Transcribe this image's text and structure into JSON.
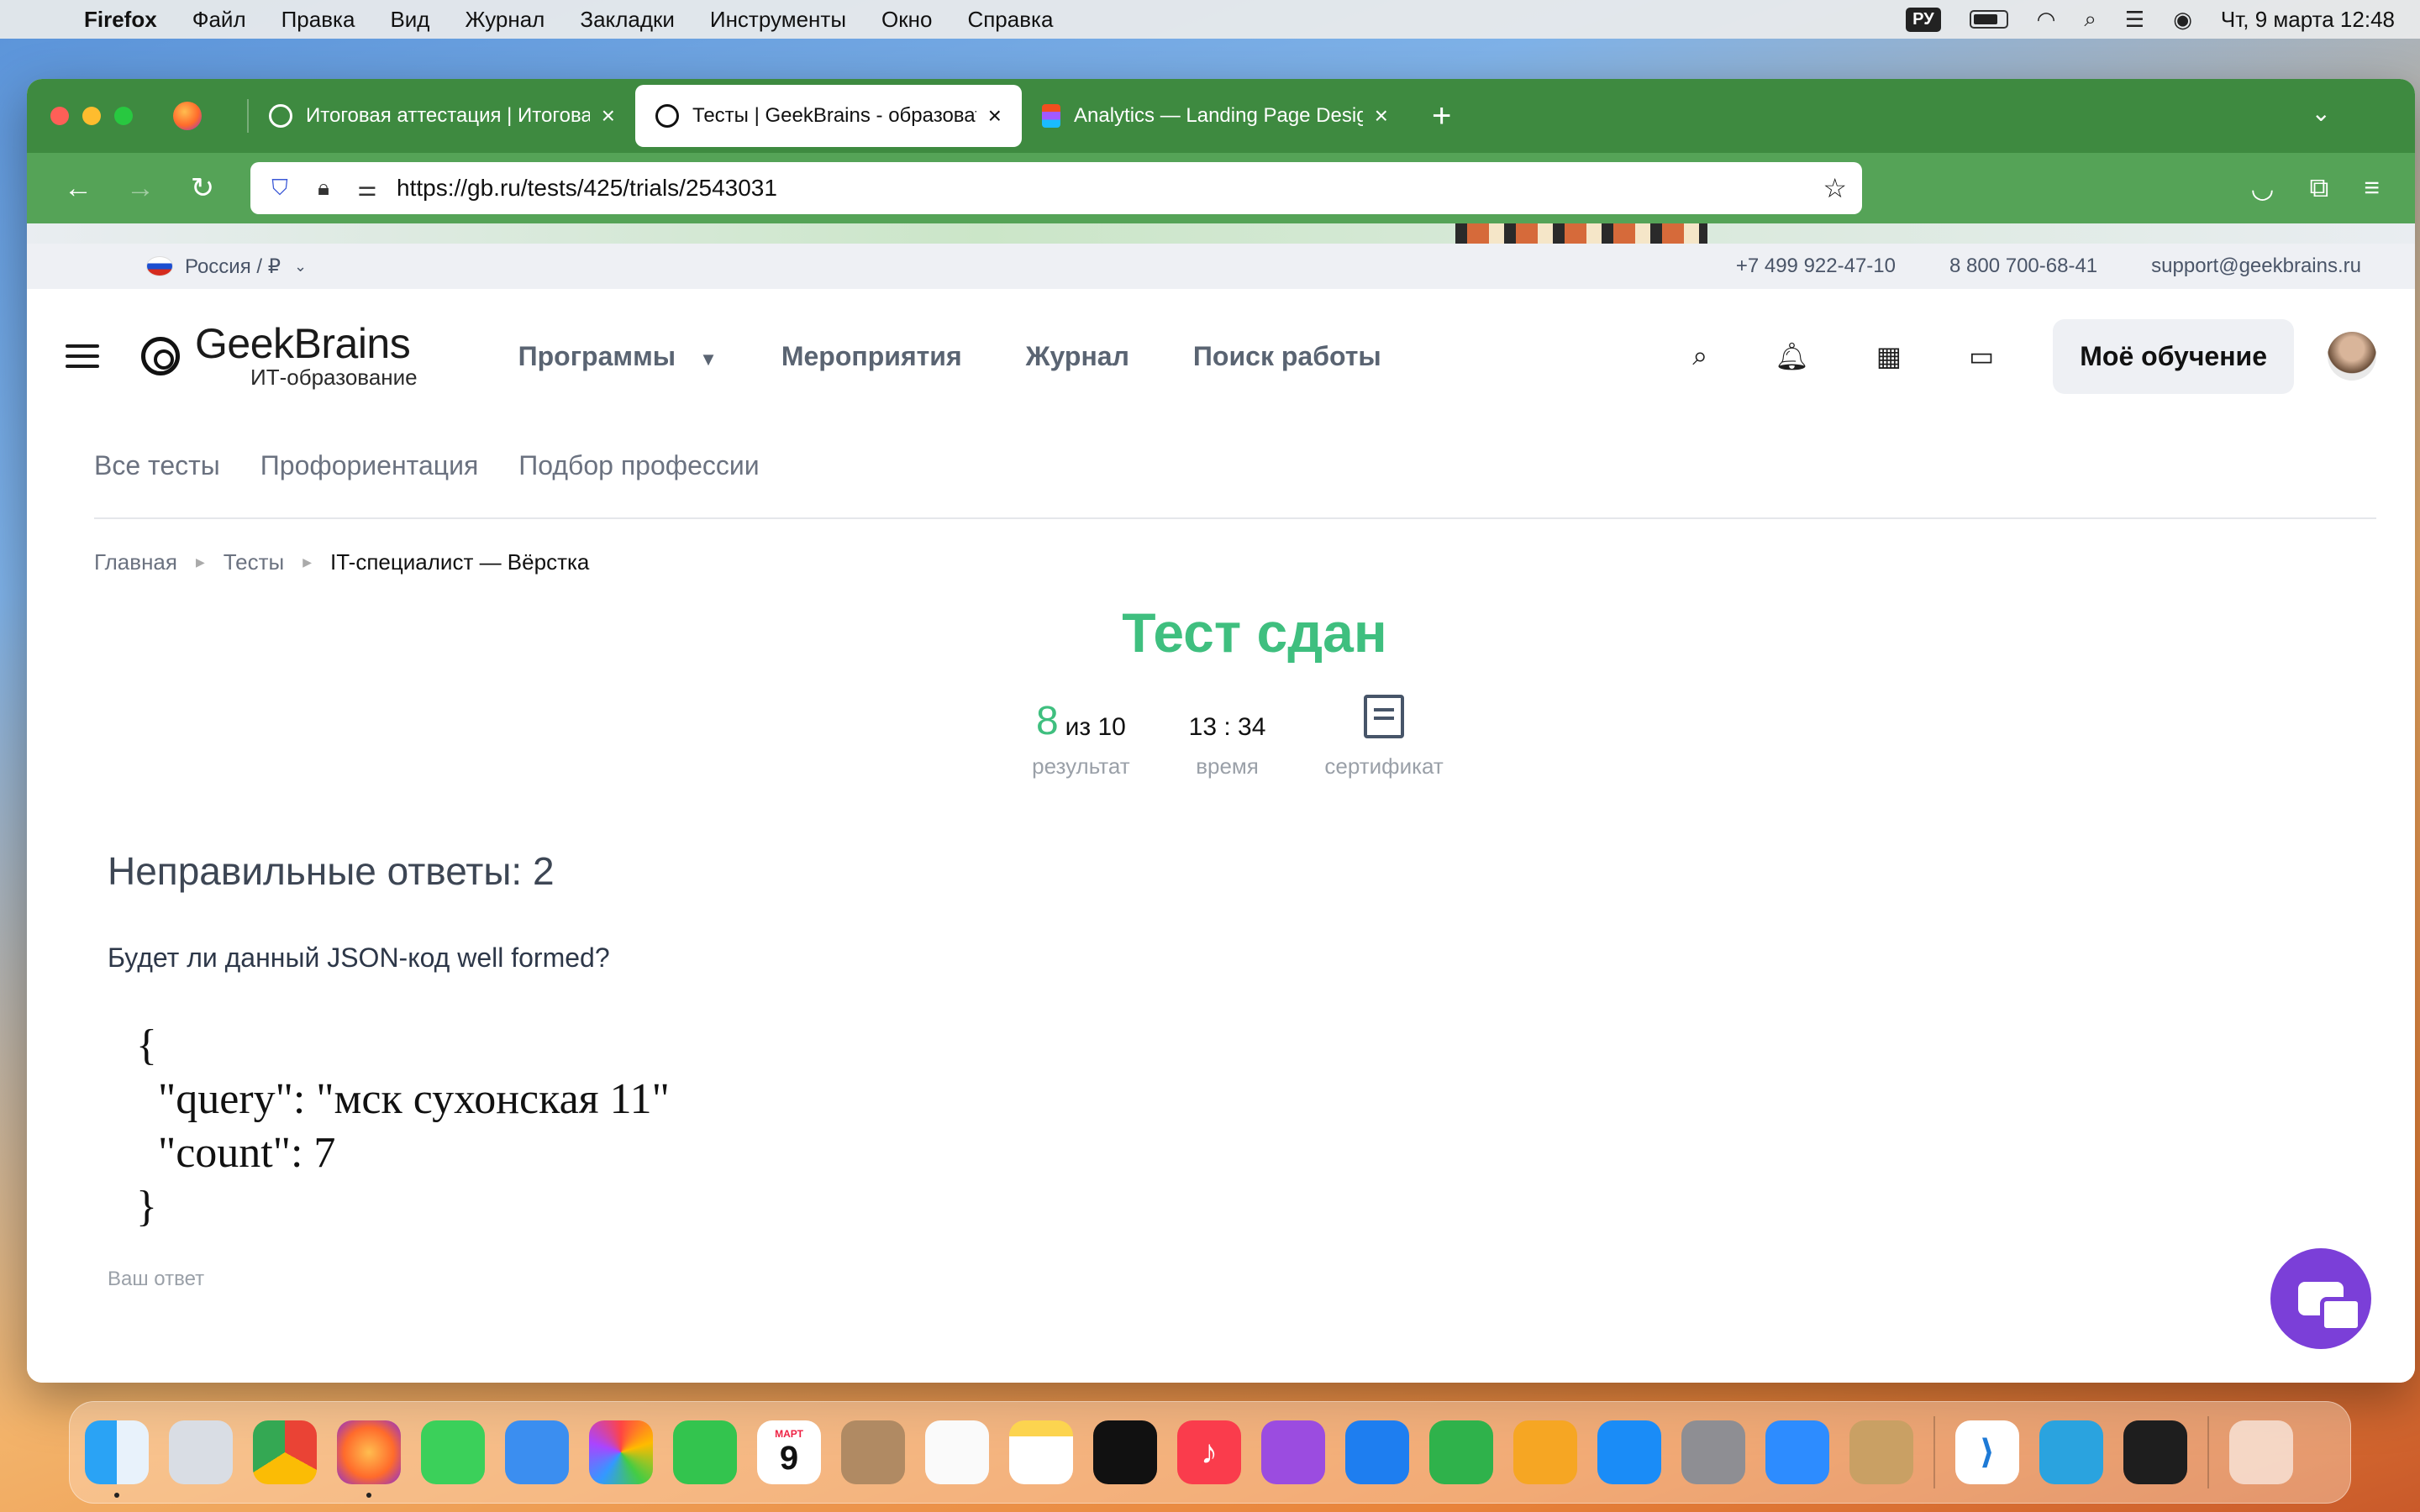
{
  "menubar": {
    "app": "Firefox",
    "items": [
      "Файл",
      "Правка",
      "Вид",
      "Журнал",
      "Закладки",
      "Инструменты",
      "Окно",
      "Справка"
    ],
    "keyboard": "РУ",
    "datetime": "Чт, 9 марта  12:48"
  },
  "browser": {
    "tabs": [
      {
        "label": "Итоговая аттестация | Итоговая",
        "active": false
      },
      {
        "label": "Тесты | GeekBrains - образоват",
        "active": true
      },
      {
        "label": "Analytics — Landing Page Desig",
        "active": false
      }
    ],
    "url": "https://gb.ru/tests/425/trials/2543031"
  },
  "site": {
    "region": "Россия / ₽",
    "phone1": "+7 499 922-47-10",
    "phone2": "8 800 700-68-41",
    "email": "support@geekbrains.ru",
    "logo_name": "GeekBrains",
    "logo_sub": "ИТ-образование",
    "nav": [
      "Программы",
      "Мероприятия",
      "Журнал",
      "Поиск работы"
    ],
    "my_learning": "Моё обучение",
    "subnav": [
      "Все тесты",
      "Профориентация",
      "Подбор профессии"
    ],
    "breadcrumbs": [
      "Главная",
      "Тесты",
      "IT-специалист — Вёрстка"
    ]
  },
  "result": {
    "title": "Тест сдан",
    "score": "8",
    "score_total": "из 10",
    "score_label": "результат",
    "time": "13 : 34",
    "time_label": "время",
    "cert_label": "сертификат"
  },
  "wrong": {
    "title": "Неправильные ответы: 2",
    "question": "Будет ли данный JSON-код well formed?",
    "code": "{\n  \"query\": \"мск сухонская 11\"\n  \"count\": 7\n}",
    "answer_label": "Ваш ответ"
  },
  "dock": {
    "calendar_month": "МАРТ",
    "calendar_day": "9"
  },
  "colors": {
    "firefox_tabbar": "#3e8a40",
    "firefox_navbar": "#55a357",
    "success_green": "#3fbf7f",
    "chat_purple": "#7b3fd8"
  }
}
